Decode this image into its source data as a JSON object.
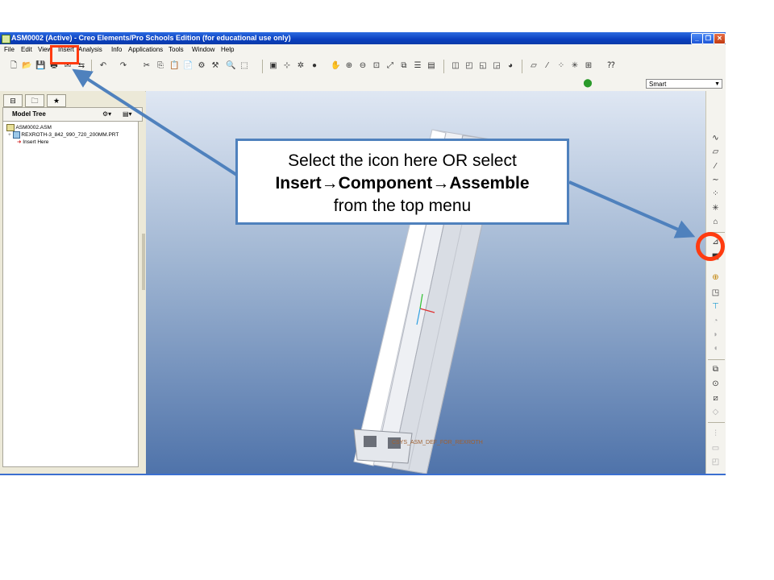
{
  "window": {
    "title": "ASM0002 (Active) - Creo Elements/Pro Schools Edition (for educational use only)"
  },
  "menu": [
    "File",
    "Edit",
    "View",
    "Insert",
    "Analysis",
    "Info",
    "Applications",
    "Tools",
    "Window",
    "Help"
  ],
  "toolbar2": {
    "filter_value": "Smart"
  },
  "model_tree": {
    "title": "Model Tree",
    "items": [
      "ASM0002.ASM",
      "REXROTH-3_842_990_720_200MM.PRT",
      "Insert Here"
    ]
  },
  "viewport": {
    "coordinate_label": "CSYS_ASM_DEF_FOR_REXROTH"
  },
  "annotation": {
    "line1": "Select the icon here OR select",
    "line2_part1": "Insert",
    "line2_part2": "Component",
    "line2_part3": "Assemble",
    "line3": "from the top menu",
    "arrow_glyph": "→",
    "highlight_color": "#ff3b10",
    "arrow_color": "#4f81bd"
  }
}
